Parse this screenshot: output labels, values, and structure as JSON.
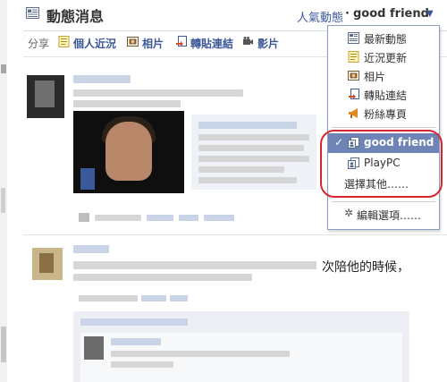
{
  "header": {
    "title": "動態消息",
    "filter_label": "人氣動態",
    "filter_separator": "·",
    "filter_value": "good friend"
  },
  "share": {
    "label": "分享",
    "items": [
      {
        "label": "個人近況",
        "icon": "status-note-icon"
      },
      {
        "label": "相片",
        "icon": "photo-icon"
      },
      {
        "label": "轉貼連結",
        "icon": "link-icon"
      },
      {
        "label": "影片",
        "icon": "video-icon"
      }
    ]
  },
  "dropdown": {
    "items": [
      {
        "label": "最新動態",
        "icon": "news-feed-icon"
      },
      {
        "label": "近況更新",
        "icon": "status-note-icon"
      },
      {
        "label": "相片",
        "icon": "photo-icon"
      },
      {
        "label": "轉貼連結",
        "icon": "link-icon"
      },
      {
        "label": "粉絲專頁",
        "icon": "megaphone-icon"
      }
    ],
    "lists": [
      {
        "label": "good friend",
        "icon": "friend-list-icon",
        "selected": true,
        "check": "✓"
      },
      {
        "label": "PlayPC",
        "icon": "friend-list-icon",
        "selected": false
      }
    ],
    "choose_other": "選擇其他……",
    "edit_options": "編輯選項……",
    "edit_icon": "✲"
  },
  "feed": {
    "post2_visible_text": "次陪他的時候，"
  },
  "colors": {
    "link": "#3b5998",
    "menu_selected": "#6d84b4",
    "highlight_circle": "#d8262d"
  }
}
